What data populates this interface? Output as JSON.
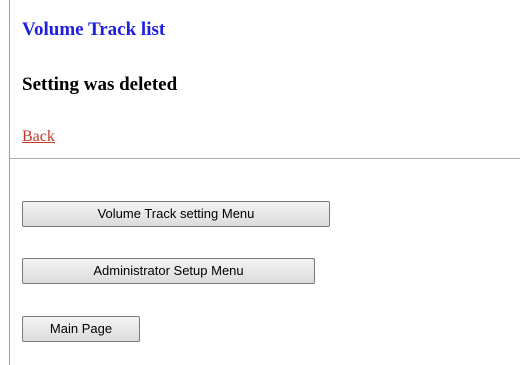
{
  "header": {
    "title": "Volume Track list"
  },
  "message": {
    "status": "Setting was deleted"
  },
  "nav": {
    "back_label": "Back"
  },
  "buttons": {
    "volume_track_menu": "Volume Track setting Menu",
    "admin_setup_menu": "Administrator Setup Menu",
    "main_page": "Main Page"
  },
  "colors": {
    "title": "#1f1fe0",
    "link": "#c0392b",
    "text": "#000000"
  }
}
